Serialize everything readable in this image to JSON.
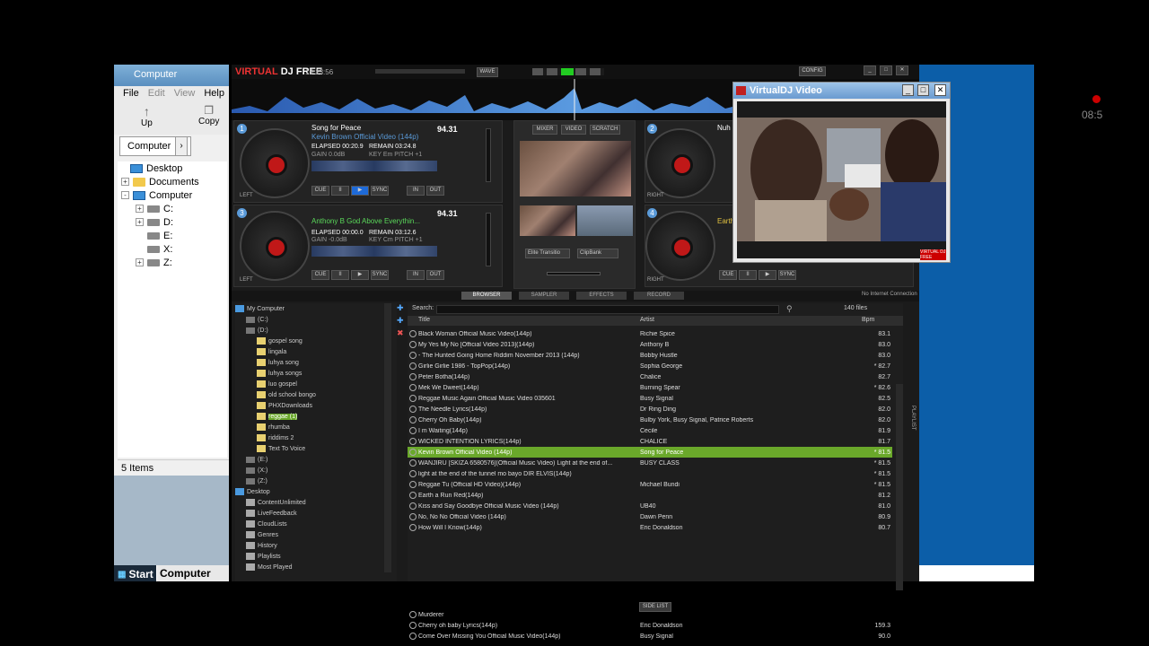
{
  "explorer": {
    "title": "Computer",
    "menu": [
      "File",
      "Edit",
      "View",
      "Help"
    ],
    "tools": {
      "up": "Up",
      "copy": "Copy"
    },
    "address": "Computer",
    "tree": [
      {
        "label": "Desktop",
        "icon": "monitor"
      },
      {
        "label": "Documents",
        "icon": "folder"
      },
      {
        "label": "Computer",
        "icon": "monitor"
      },
      {
        "label": "C:",
        "icon": "drive"
      },
      {
        "label": "D:",
        "icon": "drive"
      },
      {
        "label": "E:",
        "icon": "drive"
      },
      {
        "label": "X:",
        "icon": "drive"
      },
      {
        "label": "Z:",
        "icon": "drive"
      }
    ],
    "status": "5 Items",
    "taskbar": {
      "start": "Start",
      "window": "Computer"
    }
  },
  "clock": "08:5",
  "vdj": {
    "logo_a": "VIRTUAL",
    "logo_b": "DJ FREE",
    "time": "16:13:56",
    "wave_btn": "WAVE",
    "config": "CONFIG",
    "deck1": {
      "num": "1",
      "title": "Song for Peace",
      "artist": "Kevin Brown  Official Video (144p)",
      "bpm": "94.31",
      "elapsed": "ELAPSED 00:20.9",
      "remain": "REMAIN 03:24.8",
      "gain": "GAIN 0.0dB",
      "key": "KEY Em PITCH +1",
      "side": "LEFT"
    },
    "deck3": {
      "num": "3",
      "title": "Anthony B  God Above Everythin...",
      "bpm": "94.31",
      "elapsed": "ELAPSED 00:00.0",
      "remain": "REMAIN 03:12.6",
      "gain": "GAIN -0.0dB",
      "key": "KEY Cm PITCH +1",
      "side": "LEFT"
    },
    "deck2": {
      "num": "2",
      "title": "Nuh",
      "side": "RIGHT"
    },
    "deck4": {
      "num": "4",
      "title": "Earth",
      "side": "RIGHT"
    },
    "mixer_tabs": [
      "MIXER",
      "VIDEO",
      "SCRATCH"
    ],
    "transition": "Elite Transitio",
    "effect": "ClipBank",
    "browser_tabs": [
      "BROWSER",
      "SAMPLER",
      "EFFECTS",
      "RECORD"
    ],
    "connection": "No Internet Connection",
    "search_label": "Search:",
    "file_count": "140 files",
    "side_list": "SIDE LIST",
    "playlist_label": "PLAYLIST"
  },
  "folder_tree": [
    {
      "label": "My Computer",
      "type": "pc"
    },
    {
      "label": "(C:)",
      "type": "drive"
    },
    {
      "label": "(D:)",
      "type": "drive"
    },
    {
      "label": "gospel song",
      "type": "folder"
    },
    {
      "label": "lingala",
      "type": "folder"
    },
    {
      "label": "luhya song",
      "type": "folder"
    },
    {
      "label": "luhya songs",
      "type": "folder"
    },
    {
      "label": "luo gospel",
      "type": "folder"
    },
    {
      "label": "old school bongo",
      "type": "folder"
    },
    {
      "label": "PHXDownloads",
      "type": "folder"
    },
    {
      "label": "reggae (1)",
      "type": "folder",
      "selected": true
    },
    {
      "label": "rhumba",
      "type": "folder"
    },
    {
      "label": "riddims 2",
      "type": "folder"
    },
    {
      "label": "Text To Voice",
      "type": "folder"
    },
    {
      "label": "(E:)",
      "type": "drive"
    },
    {
      "label": "(X:)",
      "type": "drive"
    },
    {
      "label": "(Z:)",
      "type": "drive"
    },
    {
      "label": "Desktop",
      "type": "pc"
    },
    {
      "label": "ContentUnlimited",
      "type": "item"
    },
    {
      "label": "LiveFeedback",
      "type": "item"
    },
    {
      "label": "CloudLists",
      "type": "item"
    },
    {
      "label": "Genres",
      "type": "item"
    },
    {
      "label": "History",
      "type": "item"
    },
    {
      "label": "Playlists",
      "type": "item"
    },
    {
      "label": "Most Played",
      "type": "item"
    }
  ],
  "columns": {
    "title": "Title",
    "artist": "Artist",
    "bpm": "Bpm"
  },
  "tracks": [
    {
      "title": "Black Woman   Official Music Video(144p)",
      "artist": "Richie Spice",
      "bpm": "83.1"
    },
    {
      "title": "My Yes   My No [Official Video 2013](144p)",
      "artist": "Anthony B",
      "bpm": "83.0"
    },
    {
      "title": "- The Hunted   Going Home Riddim   November 2013  (144p)",
      "artist": "Bobby Hustle",
      "bpm": "83.0"
    },
    {
      "title": "Girlie Girlie  1986  - TopPop(144p)",
      "artist": "Sophia George",
      "bpm": "* 82.7"
    },
    {
      "title": "Peter Botha(144p)",
      "artist": "Chalice",
      "bpm": "82.7"
    },
    {
      "title": "Mek We Dweet(144p)",
      "artist": "Burning Spear",
      "bpm": "* 82.6"
    },
    {
      "title": "Reggae Music Again   Official Music Video 035601",
      "artist": "Busy Signal",
      "bpm": "82.5"
    },
    {
      "title": "The Needle Lyrics(144p)",
      "artist": "Dr Ring Ding",
      "bpm": "82.0"
    },
    {
      "title": "Cherry Oh Baby(144p)",
      "artist": "Bulby York, Busy Signal, Patrice Roberts",
      "bpm": "82.0"
    },
    {
      "title": "I m Waiting(144p)",
      "artist": "Cecile",
      "bpm": "81.9"
    },
    {
      "title": "WICKED INTENTION LYRICS(144p)",
      "artist": "CHALICE",
      "bpm": "81.7"
    },
    {
      "title": "Kevin Brown  Official Video (144p)",
      "artist": "Song for Peace",
      "bpm": "* 81.5",
      "selected": true
    },
    {
      "title": "WANJIRU [SKIZA 6580576](Official Music Video) Light at the end of...",
      "artist": "BUSY CLASS",
      "bpm": "* 81.5"
    },
    {
      "title": "light at the end of the tunnel mo bayo DIR ELVIS(144p)",
      "artist": "",
      "bpm": "* 81.5"
    },
    {
      "title": "Reggae Tu (Official HD Video)(144p)",
      "artist": "Michael Bundi",
      "bpm": "* 81.5"
    },
    {
      "title": "Earth a Run Red(144p)",
      "artist": "",
      "bpm": "81.2"
    },
    {
      "title": "Kiss and Say Goodbye  Official Music Video (144p)",
      "artist": "UB40",
      "bpm": "81.0"
    },
    {
      "title": "No, No No  Official Video (144p)",
      "artist": "Dawn Penn",
      "bpm": "80.9"
    },
    {
      "title": "How Will I Know(144p)",
      "artist": "Eric Donaldson",
      "bpm": "80.7"
    }
  ],
  "side_tracks": [
    {
      "title": "Murderer",
      "artist": "",
      "bpm": ""
    },
    {
      "title": "Cherry oh baby Lyrics(144p)",
      "artist": "Eric Donaldson",
      "bpm": "159.3"
    },
    {
      "title": "Come Over  Missing You    Official Music Video(144p)",
      "artist": "Busy Signal",
      "bpm": "90.0"
    }
  ],
  "video_window": {
    "title": "VirtualDJ Video",
    "watermark": "VIRTUAL DJ FREE"
  }
}
